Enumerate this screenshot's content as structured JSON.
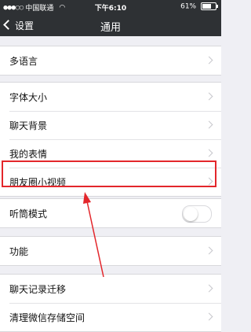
{
  "status_bar": {
    "carrier": "中国联通",
    "time": "下午6:10",
    "battery": "61%",
    "battery_level": 0.61
  },
  "nav": {
    "back_label": "设置",
    "title": "通用"
  },
  "groups": [
    {
      "items": [
        {
          "label": "多语言"
        }
      ]
    },
    {
      "items": [
        {
          "label": "字体大小"
        },
        {
          "label": "聊天背景"
        },
        {
          "label": "我的表情"
        },
        {
          "label": "朋友圈小视频"
        }
      ]
    },
    {
      "items": [
        {
          "label": "听筒模式",
          "toggle": false
        }
      ]
    },
    {
      "items": [
        {
          "label": "功能"
        }
      ]
    },
    {
      "items": [
        {
          "label": "聊天记录迁移"
        },
        {
          "label": "清理微信存储空间"
        }
      ]
    }
  ],
  "colors": {
    "highlight": "#e3262b",
    "nav_bg": "#2e3134"
  }
}
